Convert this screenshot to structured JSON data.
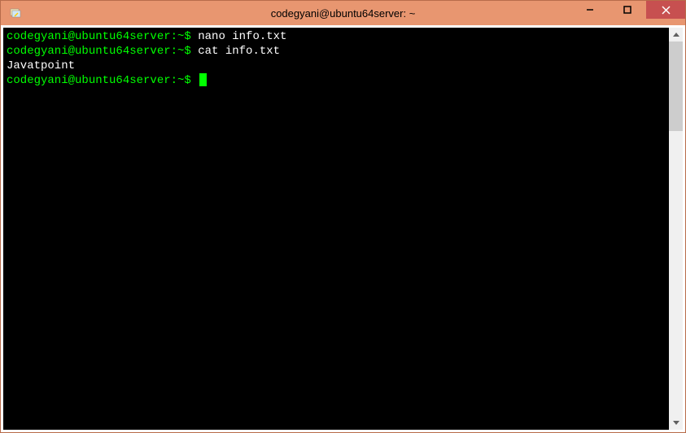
{
  "window": {
    "title": "codegyani@ubuntu64server: ~"
  },
  "terminal": {
    "lines": [
      {
        "prompt": "codegyani@ubuntu64server:~$",
        "command": " nano info.txt"
      },
      {
        "prompt": "codegyani@ubuntu64server:~$",
        "command": " cat info.txt"
      },
      {
        "output": "Javatpoint"
      },
      {
        "prompt": "codegyani@ubuntu64server:~$",
        "command": " ",
        "cursor": true
      }
    ]
  }
}
